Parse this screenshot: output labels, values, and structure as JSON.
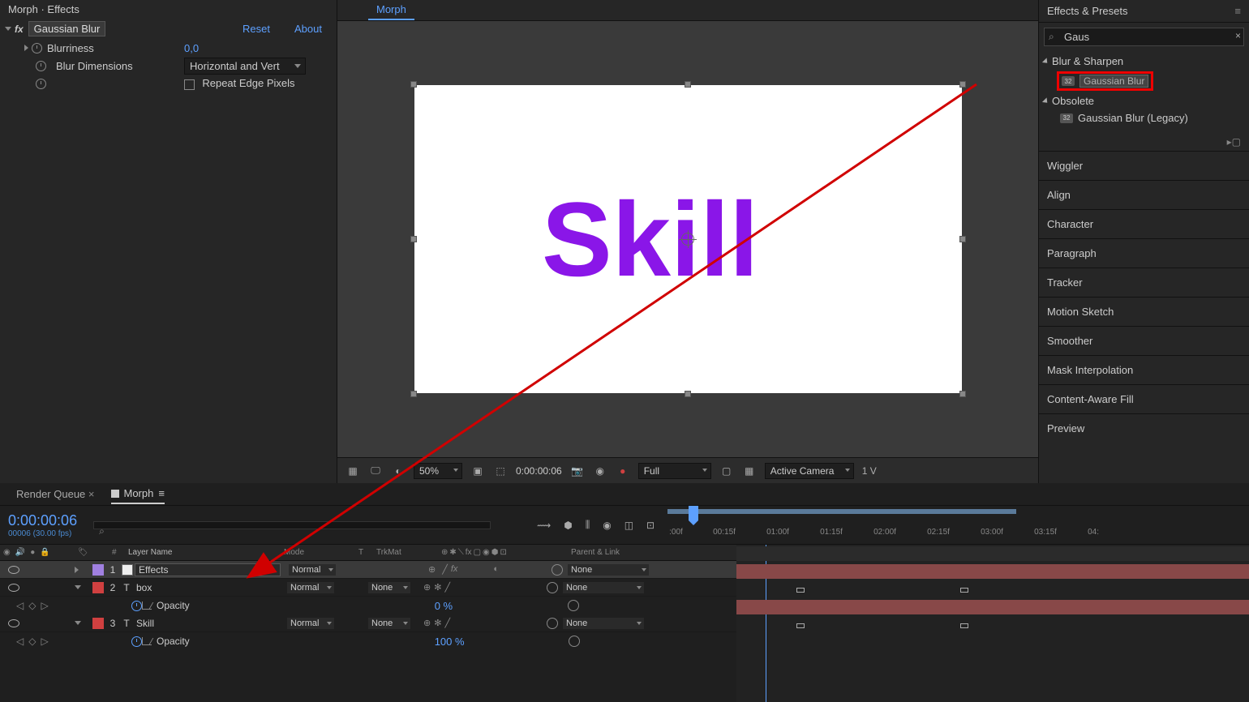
{
  "effects_panel": {
    "title": "Morph · Effects",
    "effect_name": "Gaussian Blur",
    "reset": "Reset",
    "about": "About",
    "blurriness_label": "Blurriness",
    "blurriness_value": "0,0",
    "dimensions_label": "Blur Dimensions",
    "dimensions_value": "Horizontal and Vert",
    "repeat_label": "Repeat Edge Pixels"
  },
  "viewer": {
    "tab": "Morph",
    "text": "Skill",
    "zoom": "50%",
    "time": "0:00:00:06",
    "res": "Full",
    "camera": "Active Camera",
    "views": "1 V"
  },
  "effects_presets": {
    "title": "Effects & Presets",
    "search": "Gaus",
    "cat1": "Blur & Sharpen",
    "item1": "Gaussian Blur",
    "cat2": "Obsolete",
    "item2": "Gaussian Blur (Legacy)",
    "sections": [
      "Wiggler",
      "Align",
      "Character",
      "Paragraph",
      "Tracker",
      "Motion Sketch",
      "Smoother",
      "Mask Interpolation",
      "Content-Aware Fill",
      "Preview"
    ]
  },
  "timeline": {
    "tab_queue": "Render Queue",
    "tab_comp": "Morph",
    "time": "0:00:00:06",
    "time_sub": "00006 (30.00 fps)",
    "headers": {
      "num": "#",
      "layer_name": "Layer Name",
      "mode": "Mode",
      "t": "T",
      "trkmat": "TrkMat",
      "parent": "Parent & Link"
    },
    "ruler": [
      ":00f",
      "00:15f",
      "01:00f",
      "01:15f",
      "02:00f",
      "02:15f",
      "03:00f",
      "03:15f",
      "04:"
    ],
    "layers": [
      {
        "num": "1",
        "name": "Effects",
        "mode": "Normal",
        "trkmat": "",
        "parent": "None",
        "color": "purple",
        "selected": true,
        "type": "adj"
      },
      {
        "num": "2",
        "name": "box",
        "mode": "Normal",
        "trkmat": "None",
        "parent": "None",
        "color": "red",
        "type": "text"
      },
      {
        "num": "3",
        "name": "Skill",
        "mode": "Normal",
        "trkmat": "None",
        "parent": "None",
        "color": "red",
        "type": "text"
      }
    ],
    "opacity_label": "Opacity",
    "opacity_val_0": "0 %",
    "opacity_val_100": "100 %"
  }
}
